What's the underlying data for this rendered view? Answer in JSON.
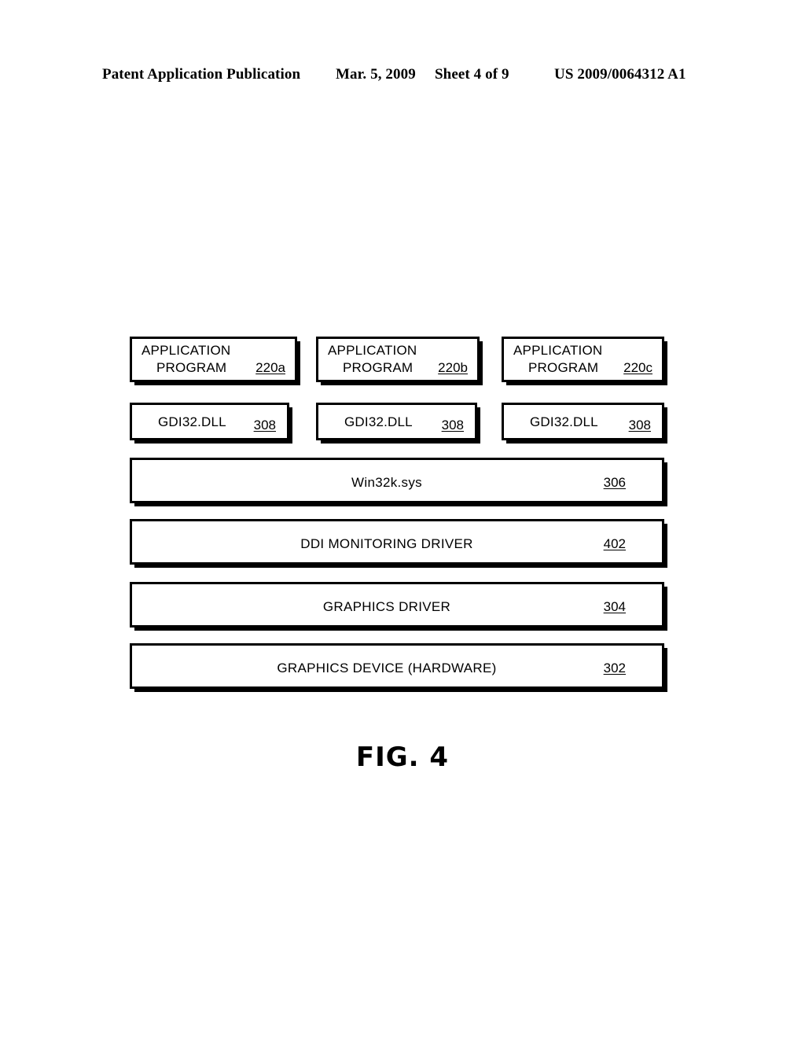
{
  "header": {
    "publication": "Patent Application Publication",
    "date": "Mar. 5, 2009",
    "sheet": "Sheet 4 of 9",
    "patent_number": "US 2009/0064312 A1"
  },
  "figure": {
    "caption": "FIG. 4",
    "application_programs": [
      {
        "line1": "APPLICATION",
        "line2": "PROGRAM",
        "ref": "220a"
      },
      {
        "line1": "APPLICATION",
        "line2": "PROGRAM",
        "ref": "220b"
      },
      {
        "line1": "APPLICATION",
        "line2": "PROGRAM",
        "ref": "220c"
      }
    ],
    "gdi_modules": [
      {
        "label": "GDI32.DLL",
        "ref": "308"
      },
      {
        "label": "GDI32.DLL",
        "ref": "308"
      },
      {
        "label": "GDI32.DLL",
        "ref": "308"
      }
    ],
    "layers": [
      {
        "label": "Win32k.sys",
        "ref": "306"
      },
      {
        "label": "DDI MONITORING DRIVER",
        "ref": "402"
      },
      {
        "label": "GRAPHICS DRIVER",
        "ref": "304"
      },
      {
        "label": "GRAPHICS DEVICE (HARDWARE)",
        "ref": "302"
      }
    ]
  },
  "colors": {
    "ink": "#000000",
    "paper": "#ffffff"
  }
}
